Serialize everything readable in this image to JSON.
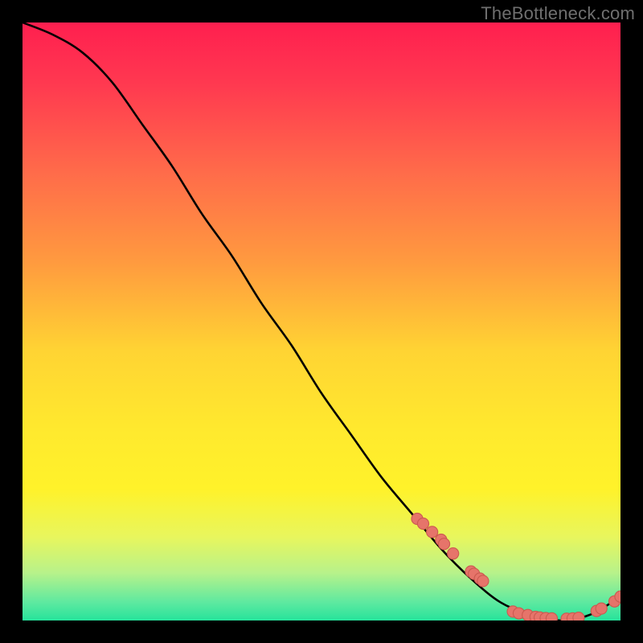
{
  "watermark": "TheBottleneck.com",
  "colors": {
    "dot_fill": "#e6746a",
    "dot_stroke": "#cc5a50",
    "curve": "#000000"
  },
  "chart_data": {
    "type": "line",
    "title": "",
    "xlabel": "",
    "ylabel": "",
    "xlim": [
      0,
      100
    ],
    "ylim": [
      0,
      100
    ],
    "grid": false,
    "legend": false,
    "series": [
      {
        "name": "curve",
        "x": [
          0,
          5,
          10,
          15,
          20,
          25,
          30,
          35,
          40,
          45,
          50,
          55,
          60,
          65,
          70,
          75,
          80,
          85,
          90,
          95,
          100
        ],
        "y": [
          100,
          98,
          95,
          90,
          83,
          76,
          68,
          61,
          53,
          46,
          38,
          31,
          24,
          18,
          12,
          7,
          3,
          1,
          0,
          1,
          4
        ]
      }
    ],
    "dots_highband": {
      "name": "highlighted-points-upper",
      "x": [
        66,
        67,
        68.5,
        70,
        70.5,
        72,
        75,
        75.5,
        76.5,
        77
      ],
      "y": [
        17,
        16.2,
        14.8,
        13.5,
        12.8,
        11.2,
        8.2,
        7.8,
        7.0,
        6.6
      ]
    },
    "dots_lowband": {
      "name": "highlighted-points-lower",
      "x": [
        82,
        83,
        84.5,
        85.8,
        86.5,
        87.5,
        88.5,
        91,
        92,
        93,
        96,
        96.8,
        99,
        100
      ],
      "y": [
        1.5,
        1.2,
        0.9,
        0.6,
        0.5,
        0.4,
        0.35,
        0.3,
        0.35,
        0.45,
        1.6,
        2.0,
        3.2,
        4.0
      ]
    },
    "gradient_stops": [
      {
        "offset": 0.0,
        "color": "#ff1f4f"
      },
      {
        "offset": 0.1,
        "color": "#ff3850"
      },
      {
        "offset": 0.25,
        "color": "#ff6b4a"
      },
      {
        "offset": 0.4,
        "color": "#ff9a3f"
      },
      {
        "offset": 0.55,
        "color": "#ffd433"
      },
      {
        "offset": 0.68,
        "color": "#ffe92e"
      },
      {
        "offset": 0.78,
        "color": "#fff22a"
      },
      {
        "offset": 0.86,
        "color": "#e8f65d"
      },
      {
        "offset": 0.92,
        "color": "#b8f28a"
      },
      {
        "offset": 0.97,
        "color": "#5de9a0"
      },
      {
        "offset": 1.0,
        "color": "#26e39b"
      }
    ]
  }
}
